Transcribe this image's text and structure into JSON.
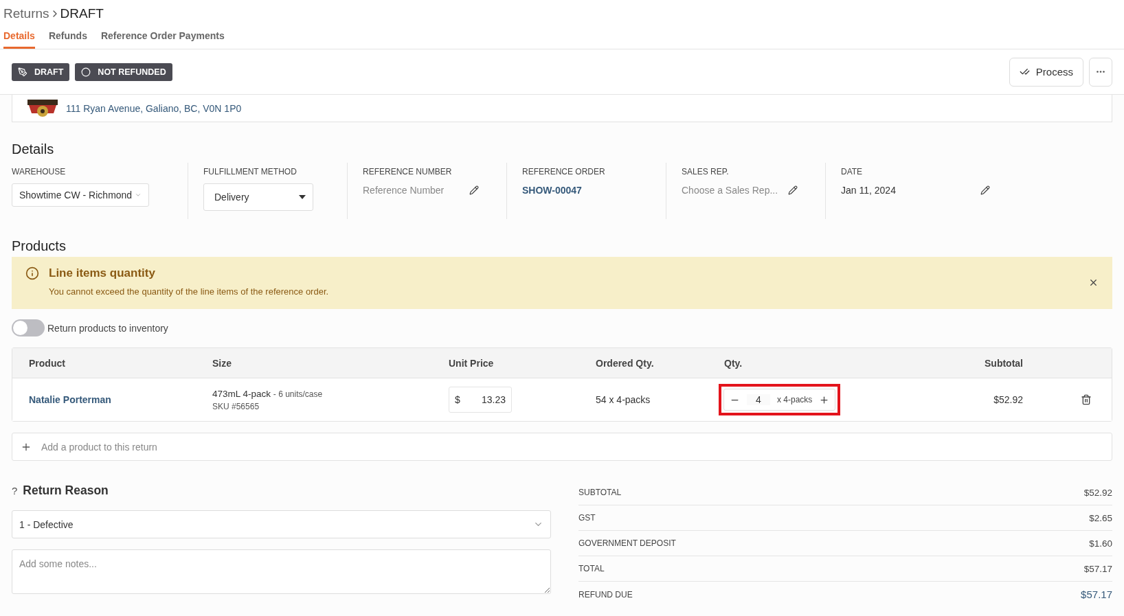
{
  "breadcrumb": {
    "parent": "Returns",
    "current": "DRAFT"
  },
  "tabs": [
    {
      "label": "Details",
      "selected": true
    },
    {
      "label": "Refunds",
      "selected": false
    },
    {
      "label": "Reference Order Payments",
      "selected": false
    }
  ],
  "status_badges": [
    {
      "kind": "draft",
      "label": "DRAFT"
    },
    {
      "kind": "refund",
      "label": "NOT REFUNDED"
    }
  ],
  "process_label": "Process",
  "address": "111 Ryan Avenue, Galiano, BC, V0N 1P0",
  "details": {
    "title": "Details",
    "fields": [
      {
        "kind": "select",
        "label": "WAREHOUSE",
        "value": "Showtime CW - Richmond"
      },
      {
        "kind": "dropdown",
        "label": "FULFILLMENT METHOD",
        "value": "Delivery"
      },
      {
        "kind": "editable",
        "label": "REFERENCE NUMBER",
        "placeholder": "Reference Number"
      },
      {
        "kind": "link",
        "label": "REFERENCE ORDER",
        "value": "SHOW-00047"
      },
      {
        "kind": "editable",
        "label": "SALES REP.",
        "placeholder": "Choose a Sales Rep..."
      },
      {
        "kind": "editable",
        "label": "DATE",
        "value": "Jan 11, 2024"
      }
    ]
  },
  "products": {
    "title": "Products",
    "alert": {
      "title": "Line items quantity",
      "message": "You cannot exceed the quantity of the line items of the reference order."
    },
    "toggle": {
      "label": "Return products to inventory",
      "on": false
    },
    "columns": [
      "Product",
      "Size",
      "Unit Price",
      "Ordered Qty.",
      "Qty.",
      "Subtotal"
    ],
    "rows": [
      {
        "product": "Natalie Porterman",
        "size": "473mL 4-pack",
        "size_note": "- 6 units/case",
        "sku": "SKU #56565",
        "currency": "$",
        "unit_price": "13.23",
        "ordered": "54 x 4-packs",
        "qty": "4",
        "qty_unit": "x 4-packs",
        "subtotal": "$52.92",
        "highlighted": true
      }
    ],
    "add_placeholder": "Add a product to this return"
  },
  "return_reason": {
    "help": "?",
    "title": "Return Reason",
    "value": "1 - Defective",
    "notes_placeholder": "Add some notes..."
  },
  "totals": [
    {
      "kind": "line",
      "label": "SUBTOTAL",
      "value": "$52.92"
    },
    {
      "kind": "line",
      "label": "GST",
      "value": "$2.65"
    },
    {
      "kind": "line",
      "label": "GOVERNMENT DEPOSIT",
      "value": "$1.60"
    },
    {
      "kind": "line",
      "label": "TOTAL",
      "value": "$57.17"
    },
    {
      "kind": "due",
      "label": "REFUND DUE",
      "value": "$57.17"
    }
  ]
}
